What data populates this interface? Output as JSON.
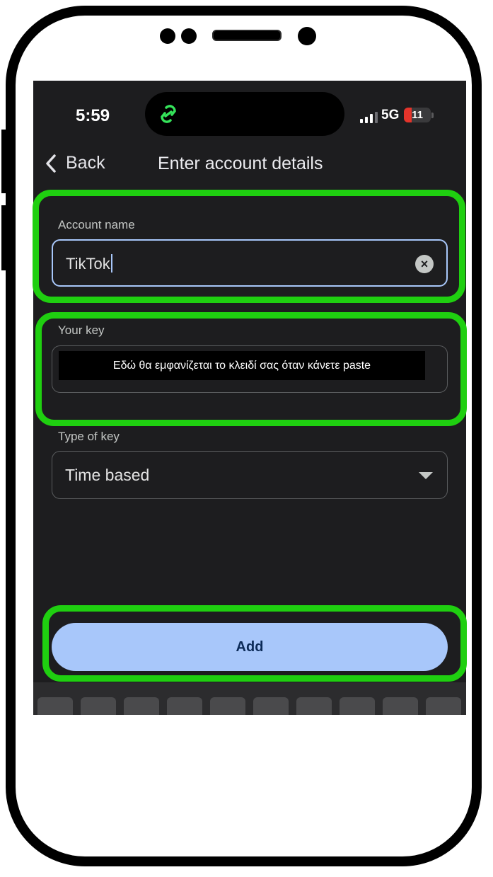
{
  "status_bar": {
    "time": "5:59",
    "network": "5G",
    "battery_level": "11",
    "signal_bars_active": 3
  },
  "header": {
    "back_label": "Back",
    "title": "Enter account details"
  },
  "form": {
    "account_name": {
      "label": "Account name",
      "value": "TikTok"
    },
    "your_key": {
      "label": "Your key",
      "overlay_note": "Εδώ θα εμφανίζεται το κλειδί σας όταν κάνετε paste"
    },
    "type_of_key": {
      "label": "Type of key",
      "selected": "Time based"
    }
  },
  "actions": {
    "add_label": "Add"
  },
  "colors": {
    "background": "#1d1d1f",
    "accent": "#a8c7fa",
    "highlight": "#1fcf10",
    "button_text": "#0b2a57",
    "battery_low": "#e5342b"
  },
  "icons": [
    "chevron-left-icon",
    "clear-icon",
    "dropdown-arrow-icon",
    "link-icon",
    "signal-icon",
    "battery-icon"
  ]
}
